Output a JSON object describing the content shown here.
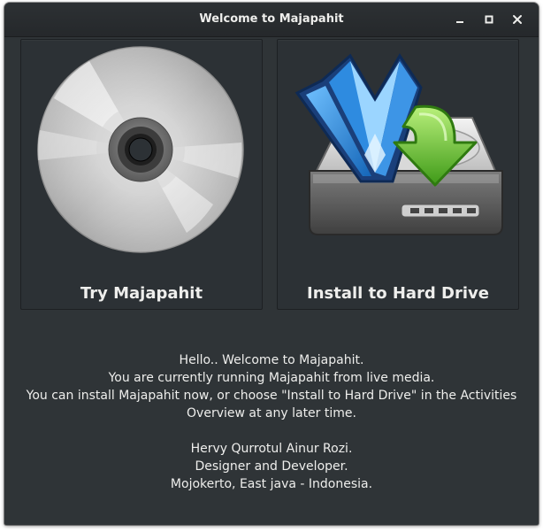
{
  "window": {
    "title": "Welcome to Majapahit",
    "controls": {
      "minimize_icon": "minimize-icon",
      "maximize_icon": "maximize-icon",
      "close_icon": "close-icon"
    }
  },
  "options": {
    "try": {
      "label": "Try Majapahit",
      "icon": "optical-disc-icon"
    },
    "install": {
      "label": "Install to Hard Drive",
      "icon": "install-hard-drive-icon"
    }
  },
  "message": {
    "lines": [
      "Hello.. Welcome to Majapahit.",
      "You are currently running Majapahit from live media.",
      "You can install Majapahit now, or choose \"Install to Hard Drive\" in the Activities",
      "Overview at any later time."
    ],
    "credits": [
      "Hervy Qurrotul Ainur Rozi.",
      "Designer and Developer.",
      "Mojokerto, East java - Indonesia."
    ]
  },
  "colors": {
    "window_bg": "#2f3437",
    "titlebar_bg": "#25282b",
    "text": "#eeeeec",
    "tile_bg": "#2c3135",
    "crystal_blue": "#1a73c9",
    "arrow_green": "#5cb82a"
  }
}
